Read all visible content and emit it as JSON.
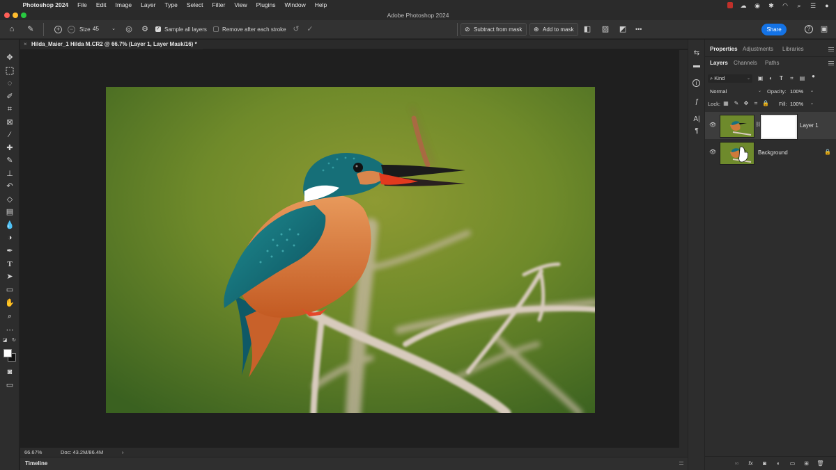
{
  "menubar": {
    "app_name": "Photoshop 2024",
    "items": [
      "File",
      "Edit",
      "Image",
      "Layer",
      "Type",
      "Select",
      "Filter",
      "View",
      "Plugins",
      "Window",
      "Help"
    ]
  },
  "window": {
    "title": "Adobe Photoshop 2024"
  },
  "options_bar": {
    "size_label": "Size",
    "size_value": "45",
    "sample_all_layers_label": "Sample all layers",
    "sample_all_layers_checked": true,
    "remove_after_stroke_label": "Remove after each stroke",
    "remove_after_stroke_checked": false,
    "subtract_from_mask_label": "Subtract from mask",
    "add_to_mask_label": "Add to mask",
    "more_label": "•••",
    "share_label": "Share"
  },
  "document": {
    "tab_title": "Hilda_Maier_1 Hilda M.CR2 @ 66.7% (Layer 1, Layer Mask/16) *",
    "close_glyph": "×"
  },
  "status": {
    "zoom": "66.67%",
    "doc_info": "Doc: 43.2M/86.4M",
    "arrow": "›"
  },
  "timeline": {
    "label": "Timeline"
  },
  "properties_tabs": [
    "Properties",
    "Adjustments",
    "Libraries"
  ],
  "layers_tabs": [
    "Layers",
    "Channels",
    "Paths"
  ],
  "layers_panel": {
    "kind_label": "Kind",
    "blend_mode": "Normal",
    "opacity_label": "Opacity:",
    "opacity_value": "100%",
    "lock_label": "Lock:",
    "fill_label": "Fill:",
    "fill_value": "100%",
    "layers": [
      {
        "name": "Layer 1",
        "selected": true,
        "has_mask": true
      },
      {
        "name": "Background",
        "selected": false,
        "locked": true
      }
    ]
  },
  "colors": {
    "accent": "#1473e6",
    "panel": "#2d2d2d",
    "canvas_bg": "#1f1f1f",
    "close": "#ff5f57",
    "minimize": "#febc2e",
    "maximize": "#28c840"
  }
}
